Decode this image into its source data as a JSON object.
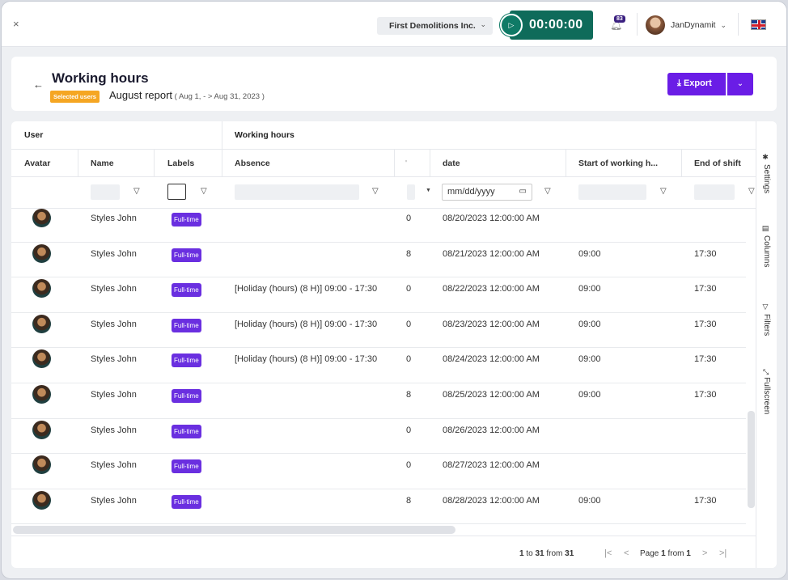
{
  "topbar": {
    "close_icon": "×",
    "company": "First Demolitions Inc.",
    "company_chevron": "⌄",
    "timer": "00:00:00",
    "notifications_count": "83",
    "username": "JanDynamit",
    "user_chevron": "⌄"
  },
  "page": {
    "back_icon": "←",
    "title": "Working hours",
    "badge": "Selected users",
    "report": "August report",
    "range": " ( Aug 1, - > Aug 31, 2023 )",
    "export_label": "Export",
    "export_icon": "⤓",
    "export_caret": "⌄"
  },
  "grid": {
    "groups": {
      "user": "User",
      "working_hours": "Working hours"
    },
    "headers": {
      "avatar": "Avatar",
      "name": "Name",
      "labels": "Labels",
      "absence": "Absence",
      "hours": "'",
      "date": "date",
      "start": "Start of working h...",
      "end": "End of shift"
    },
    "date_placeholder": "mm/dd/yyyy",
    "rows": [
      {
        "name": "Styles John",
        "label": "Full-time",
        "absence": "",
        "hours": "0",
        "date": "08/20/2023 12:00:00 AM",
        "start": "",
        "end": ""
      },
      {
        "name": "Styles John",
        "label": "Full-time",
        "absence": "",
        "hours": "8",
        "date": "08/21/2023 12:00:00 AM",
        "start": "09:00",
        "end": "17:30"
      },
      {
        "name": "Styles John",
        "label": "Full-time",
        "absence": "[Holiday (hours) (8 H)] 09:00 - 17:30",
        "hours": "0",
        "date": "08/22/2023 12:00:00 AM",
        "start": "09:00",
        "end": "17:30"
      },
      {
        "name": "Styles John",
        "label": "Full-time",
        "absence": "[Holiday (hours) (8 H)] 09:00 - 17:30",
        "hours": "0",
        "date": "08/23/2023 12:00:00 AM",
        "start": "09:00",
        "end": "17:30"
      },
      {
        "name": "Styles John",
        "label": "Full-time",
        "absence": "[Holiday (hours) (8 H)] 09:00 - 17:30",
        "hours": "0",
        "date": "08/24/2023 12:00:00 AM",
        "start": "09:00",
        "end": "17:30"
      },
      {
        "name": "Styles John",
        "label": "Full-time",
        "absence": "",
        "hours": "8",
        "date": "08/25/2023 12:00:00 AM",
        "start": "09:00",
        "end": "17:30"
      },
      {
        "name": "Styles John",
        "label": "Full-time",
        "absence": "",
        "hours": "0",
        "date": "08/26/2023 12:00:00 AM",
        "start": "",
        "end": ""
      },
      {
        "name": "Styles John",
        "label": "Full-time",
        "absence": "",
        "hours": "0",
        "date": "08/27/2023 12:00:00 AM",
        "start": "",
        "end": ""
      },
      {
        "name": "Styles John",
        "label": "Full-time",
        "absence": "",
        "hours": "8",
        "date": "08/28/2023 12:00:00 AM",
        "start": "09:00",
        "end": "17:30"
      }
    ],
    "footer": {
      "from_row": "1",
      "to_word": " to ",
      "to_row": "31",
      "from_word": " from ",
      "total": "31",
      "page_word": "Page ",
      "page": "1",
      "page_from_word": " from ",
      "page_total": "1",
      "first_icon": "|<",
      "prev_icon": "<",
      "next_icon": ">",
      "last_icon": ">|"
    }
  },
  "sidebar": {
    "settings": "Settings",
    "columns": "Columns",
    "filters": "Filters",
    "fullscreen": "Fullscreen"
  },
  "colors": {
    "accent": "#6a1de6",
    "timer": "#0f6b5a",
    "badge": "#f5a623",
    "tag": "#6a2fe0"
  }
}
